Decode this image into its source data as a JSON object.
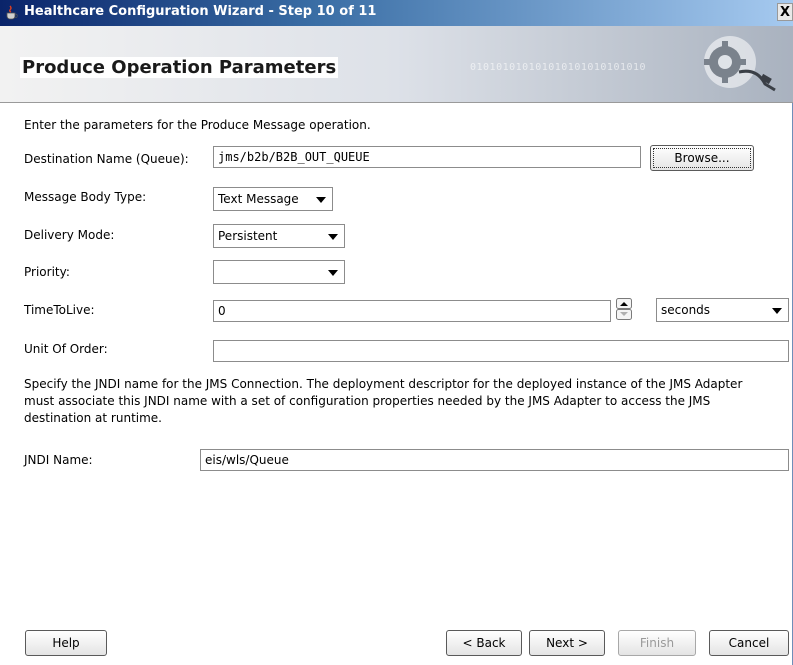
{
  "window": {
    "title": "Healthcare Configuration Wizard - Step 10 of 11",
    "close_glyph": "X"
  },
  "banner": {
    "heading": "Produce Operation Parameters",
    "binary_text": "010101010101010101010101010"
  },
  "intro": "Enter the parameters for the Produce Message operation.",
  "destination": {
    "label": "Destination Name (Queue):",
    "value": "jms/b2b/B2B_OUT_QUEUE",
    "browse_label": "Browse..."
  },
  "message_body_type": {
    "label": "Message Body Type:",
    "value": "Text Message"
  },
  "delivery_mode": {
    "label": "Delivery Mode:",
    "value": "Persistent"
  },
  "priority": {
    "label": "Priority:",
    "value": ""
  },
  "time_to_live": {
    "label": "TimeToLive:",
    "value": "0",
    "unit": "seconds"
  },
  "unit_of_order": {
    "label": "Unit Of Order:",
    "value": ""
  },
  "jndi_description": "Specify the JNDI name for the JMS Connection.  The deployment descriptor for the deployed instance of the JMS Adapter must associate this JNDI name with a set of configuration properties needed by the JMS Adapter to access the JMS destination at runtime.",
  "jndi": {
    "label": "JNDI Name:",
    "value": "eis/wls/Queue"
  },
  "buttons": {
    "help": "Help",
    "back": "< Back",
    "next": "Next >",
    "finish": "Finish",
    "cancel": "Cancel"
  },
  "colors": {
    "title_bar": "#0a246a",
    "banner_right": "#a9b2bf"
  },
  "icons": [
    "app-cup-icon",
    "gear-plug-icon",
    "close-icon",
    "spinner-icon",
    "dropdown-arrow-icon"
  ]
}
